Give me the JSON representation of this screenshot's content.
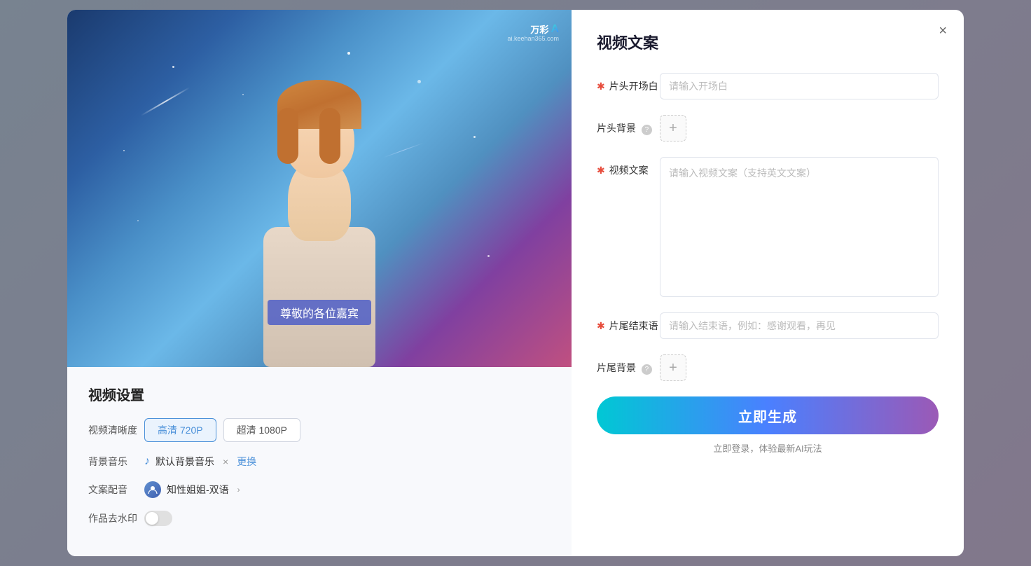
{
  "modal": {
    "close_label": "×",
    "left": {
      "watermark_brand": "万彩",
      "watermark_ai": "A",
      "watermark_sub": "ai.keehan365.com",
      "subtitle_text": "尊敬的各位嘉宾",
      "settings_title": "视频设置",
      "quality_label": "视频清晰度",
      "quality_options": [
        {
          "label": "高清 720P",
          "active": true
        },
        {
          "label": "超清 1080P",
          "active": false
        }
      ],
      "music_label": "背景音乐",
      "music_note_icon": "♪",
      "music_name": "默认背景音乐",
      "music_delete": "×",
      "music_replace": "更换",
      "voice_label": "文案配音",
      "voice_name": "知性姐姐-双语",
      "voice_arrow": "›",
      "watermark_label": "作品去水印"
    },
    "right": {
      "panel_title": "视频文案",
      "opening_label": "片头开场白",
      "opening_required": "✱",
      "opening_placeholder": "请输入开场白",
      "bg_label": "片头背景",
      "bg_info": "?",
      "bg_add": "+",
      "content_label": "视频文案",
      "content_required": "✱",
      "content_placeholder": "请输入视频文案（支持英文文案）",
      "ending_label": "片尾结束语",
      "ending_required": "✱",
      "ending_placeholder": "请输入结束语，例如：感谢观看，再见",
      "ending_bg_label": "片尾背景",
      "ending_bg_info": "?",
      "ending_bg_add": "+",
      "generate_label": "立即生成",
      "generate_hint": "立即登录，体验最新AI玩法"
    }
  }
}
